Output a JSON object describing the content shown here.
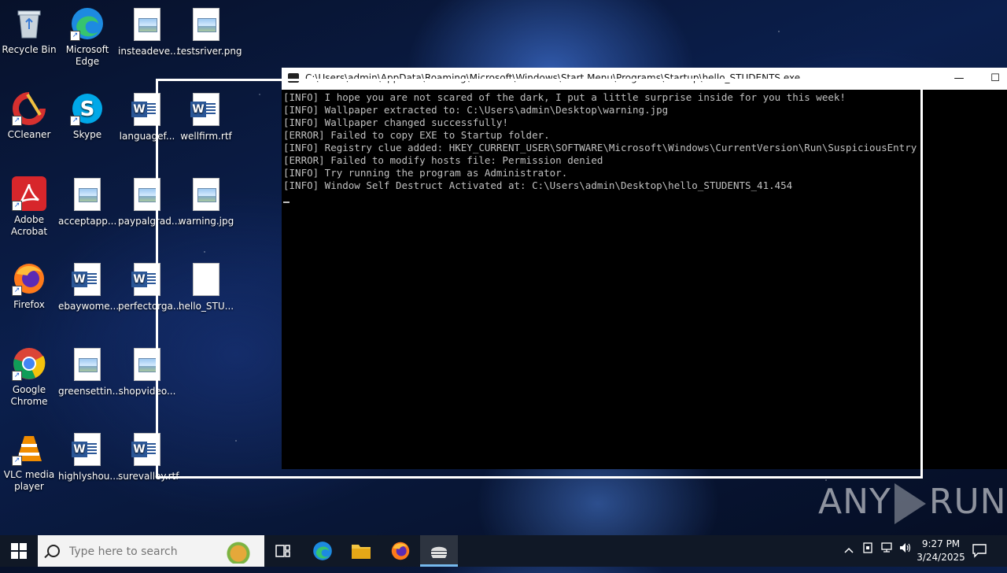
{
  "desktop": {
    "icons": [
      {
        "label": "Recycle Bin",
        "kind": "recycle-bin"
      },
      {
        "label": "Microsoft Edge",
        "kind": "edge"
      },
      {
        "label": "insteadeve...",
        "kind": "image-file"
      },
      {
        "label": "testsriver.png",
        "kind": "image-file"
      },
      {
        "label": "CCleaner",
        "kind": "ccleaner"
      },
      {
        "label": "Skype",
        "kind": "skype"
      },
      {
        "label": "languagef...",
        "kind": "word-doc"
      },
      {
        "label": "wellfirm.rtf",
        "kind": "word-doc"
      },
      {
        "label": "Adobe Acrobat",
        "kind": "acrobat"
      },
      {
        "label": "acceptapp...",
        "kind": "image-file"
      },
      {
        "label": "paypalgrad...",
        "kind": "image-file"
      },
      {
        "label": "warning.jpg",
        "kind": "image-file"
      },
      {
        "label": "Firefox",
        "kind": "firefox"
      },
      {
        "label": "ebaywome...",
        "kind": "word-doc"
      },
      {
        "label": "perfectorga...",
        "kind": "word-doc"
      },
      {
        "label": "hello_STU...",
        "kind": "blank-file"
      },
      {
        "label": "Google Chrome",
        "kind": "chrome"
      },
      {
        "label": "greensettin...",
        "kind": "image-file"
      },
      {
        "label": "shopvideo...",
        "kind": "image-file"
      },
      {
        "label": "VLC media player",
        "kind": "vlc"
      },
      {
        "label": "highlyshou...",
        "kind": "word-doc"
      },
      {
        "label": "surevalley.rtf",
        "kind": "word-doc"
      }
    ]
  },
  "console": {
    "title": "C:\\Users\\admin\\AppData\\Roaming\\Microsoft\\Windows\\Start Menu\\Programs\\Startup\\hello_STUDENTS.exe",
    "lines": [
      "[INFO] I hope you are not scared of the dark, I put a little surprise inside for you this week!",
      "[INFO] Wallpaper extracted to: C:\\Users\\admin\\Desktop\\warning.jpg",
      "[INFO] Wallpaper changed successfully!",
      "[ERROR] Failed to copy EXE to Startup folder.",
      "[INFO] Registry clue added: HKEY_CURRENT_USER\\SOFTWARE\\Microsoft\\Windows\\CurrentVersion\\Run\\SuspiciousEntry",
      "[ERROR] Failed to modify hosts file: Permission denied",
      "[INFO] Try running the program as Administrator.",
      "[INFO] Window Self Destruct Activated at: C:\\Users\\admin\\Desktop\\hello_STUDENTS_41.454"
    ],
    "minimize_glyph": "—",
    "maximize_glyph": "☐"
  },
  "watermark": {
    "left": "ANY",
    "right": "RUN"
  },
  "taskbar": {
    "search_placeholder": "Type here to search",
    "clock_time": "9:27 PM",
    "clock_date": "3/24/2025"
  }
}
